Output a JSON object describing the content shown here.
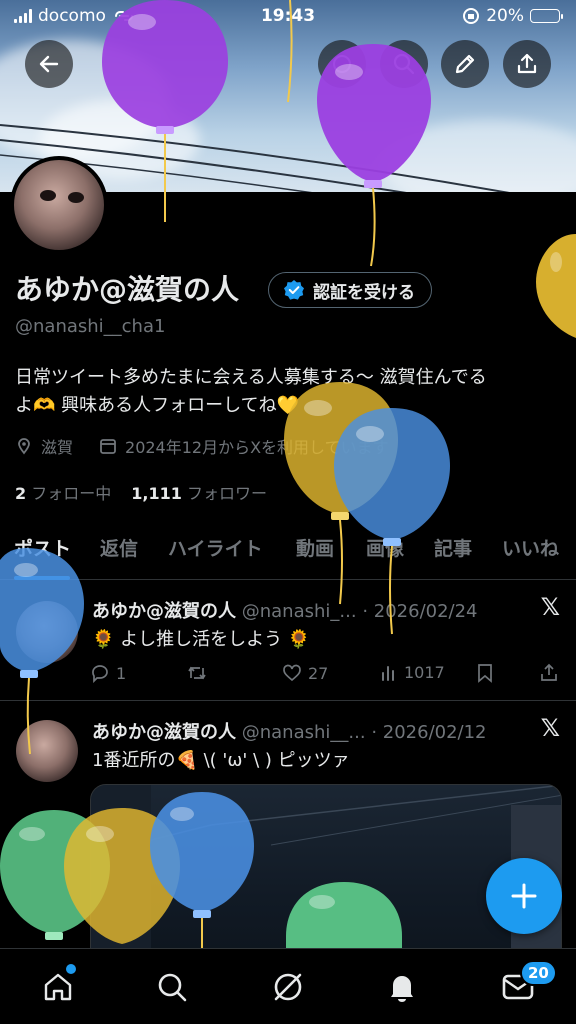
{
  "status_bar": {
    "carrier": "docomo",
    "time": "19:43",
    "battery": "20%",
    "battery_level": 0.2
  },
  "profile": {
    "name": "あゆか@滋賀の人",
    "verify_label": "認証を受ける",
    "handle": "@nanashi__cha1",
    "bio_line1": "日常ツイート多めたまに会える人募集する〜 滋賀住んでる",
    "bio_line2": "よ🫶 興味ある人フォローしてね💛",
    "location": "滋賀",
    "joined": "2024年12月からXを利用しています",
    "following_count": "2",
    "following_label": "フォロー中",
    "followers_count": "1,111",
    "followers_label": "フォロワー"
  },
  "tabs": [
    "ポスト",
    "返信",
    "ハイライト",
    "動画",
    "画像",
    "記事",
    "いいね"
  ],
  "posts": [
    {
      "name": "あゆか@滋賀の人",
      "handle": "@nanashi_...",
      "date": "· 2026/02/24",
      "text": "🌻 よし推し活をしよう 🌻",
      "replies": "1",
      "reposts": "",
      "likes": "27",
      "views": "1017"
    },
    {
      "name": "あゆか@滋賀の人",
      "handle": "@nanashi__...",
      "date": "· 2026/02/12",
      "text": "1番近所の🍕 \\( 'ω' \\ ) ピッツァ"
    }
  ],
  "badges": {
    "messages": "20"
  },
  "colors": {
    "accent": "#1d9bf0",
    "background": "#000000",
    "muted": "#71767b"
  },
  "icons": [
    "back-icon",
    "search-icon",
    "edit-icon",
    "share-icon",
    "verified-icon",
    "location-icon",
    "calendar-icon",
    "x-logo-icon",
    "home-icon",
    "explore-icon",
    "grok-icon",
    "notifications-icon",
    "messages-icon",
    "compose-icon"
  ]
}
